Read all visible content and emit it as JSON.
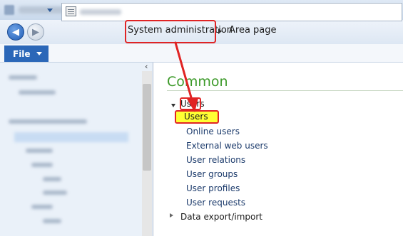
{
  "nav": {
    "breadcrumb": [
      "System administration",
      "Area page"
    ]
  },
  "ribbon": {
    "file_label": "File"
  },
  "content": {
    "heading": "Common",
    "groups": [
      {
        "label": "Users",
        "expanded": true,
        "items": [
          "Users",
          "Online users",
          "External web users",
          "User relations",
          "User groups",
          "User profiles",
          "User requests"
        ]
      },
      {
        "label": "Data export/import",
        "expanded": false,
        "items": []
      }
    ]
  },
  "annotation": {
    "highlight_color": "#e02424",
    "marker_color": "#ffff33"
  },
  "colors": {
    "heading": "#3d9a2a",
    "link": "#1b3a6b",
    "file_tab": "#2b67b8"
  },
  "icons": {
    "back": "back-arrow-icon",
    "forward": "forward-arrow-icon",
    "address": "page-icon",
    "group_expanded": "triangle-down-icon",
    "group_collapsed": "triangle-right-icon"
  }
}
